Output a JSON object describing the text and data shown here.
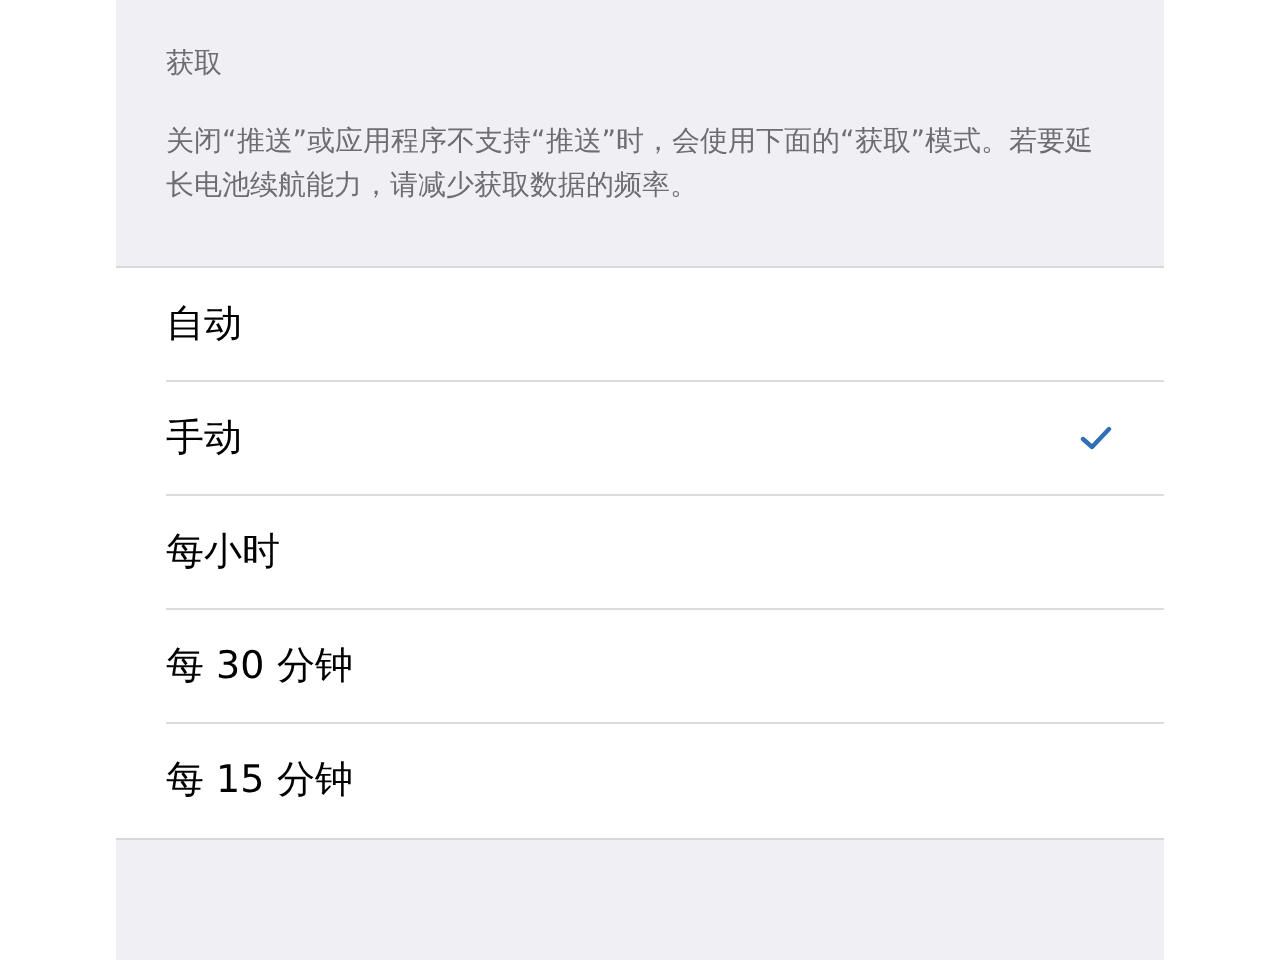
{
  "section": {
    "title": "获取",
    "description": "关闭“推送”或应用程序不支持“推送”时，会使用下面的“获取”模式。若要延长电池续航能力，请减少获取数据的频率。"
  },
  "options": [
    {
      "label": "自动",
      "selected": false
    },
    {
      "label": "手动",
      "selected": true
    },
    {
      "label": "每小时",
      "selected": false
    },
    {
      "label": "每 30 分钟",
      "selected": false
    },
    {
      "label": "每 15 分钟",
      "selected": false
    }
  ]
}
